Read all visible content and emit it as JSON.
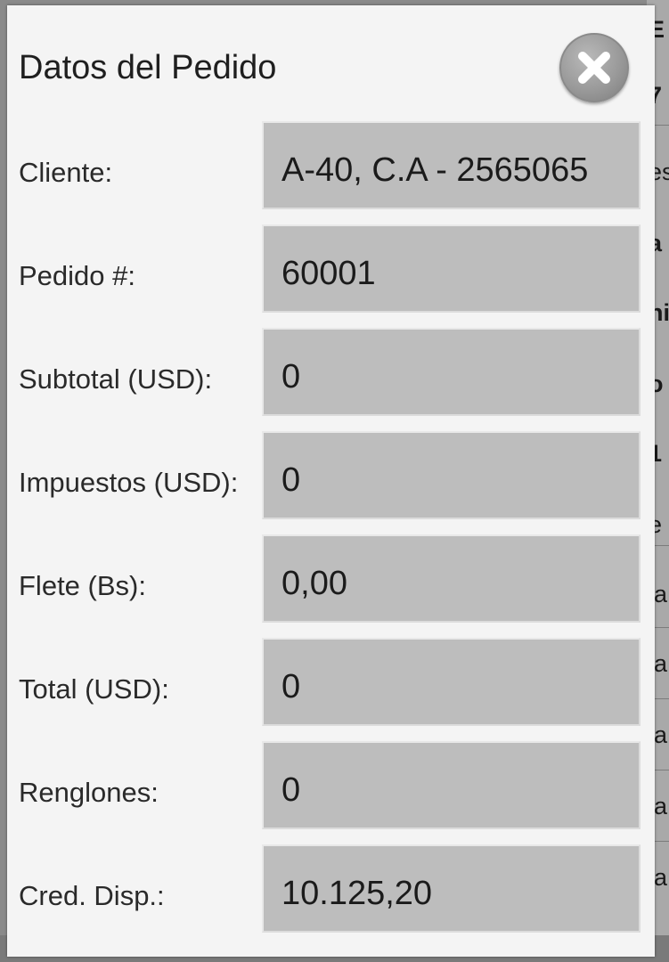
{
  "dialog": {
    "title": "Datos del Pedido",
    "close_icon": "close-x-icon",
    "fields": [
      {
        "label": "Cliente:",
        "value": "A-40, C.A - 2565065"
      },
      {
        "label": "Pedido #:",
        "value": "60001"
      },
      {
        "label": "Subtotal (USD):",
        "value": "0"
      },
      {
        "label": "Impuestos (USD):",
        "value": "0"
      },
      {
        "label": "Flete (Bs):",
        "value": "0,00"
      },
      {
        "label": "Total (USD):",
        "value": "0"
      },
      {
        "label": "Renglones:",
        "value": "0"
      },
      {
        "label": "Cred. Disp.:",
        "value": "10.125,20"
      }
    ]
  },
  "background": {
    "fragments": [
      "E",
      "7",
      "es",
      "a",
      "ni",
      "o",
      "1",
      "e",
      "la",
      "la",
      "la",
      "la",
      "la"
    ]
  },
  "colors": {
    "dialog_bg": "#f4f4f4",
    "field_bg": "#bdbdbd",
    "text": "#1f1f1f"
  }
}
